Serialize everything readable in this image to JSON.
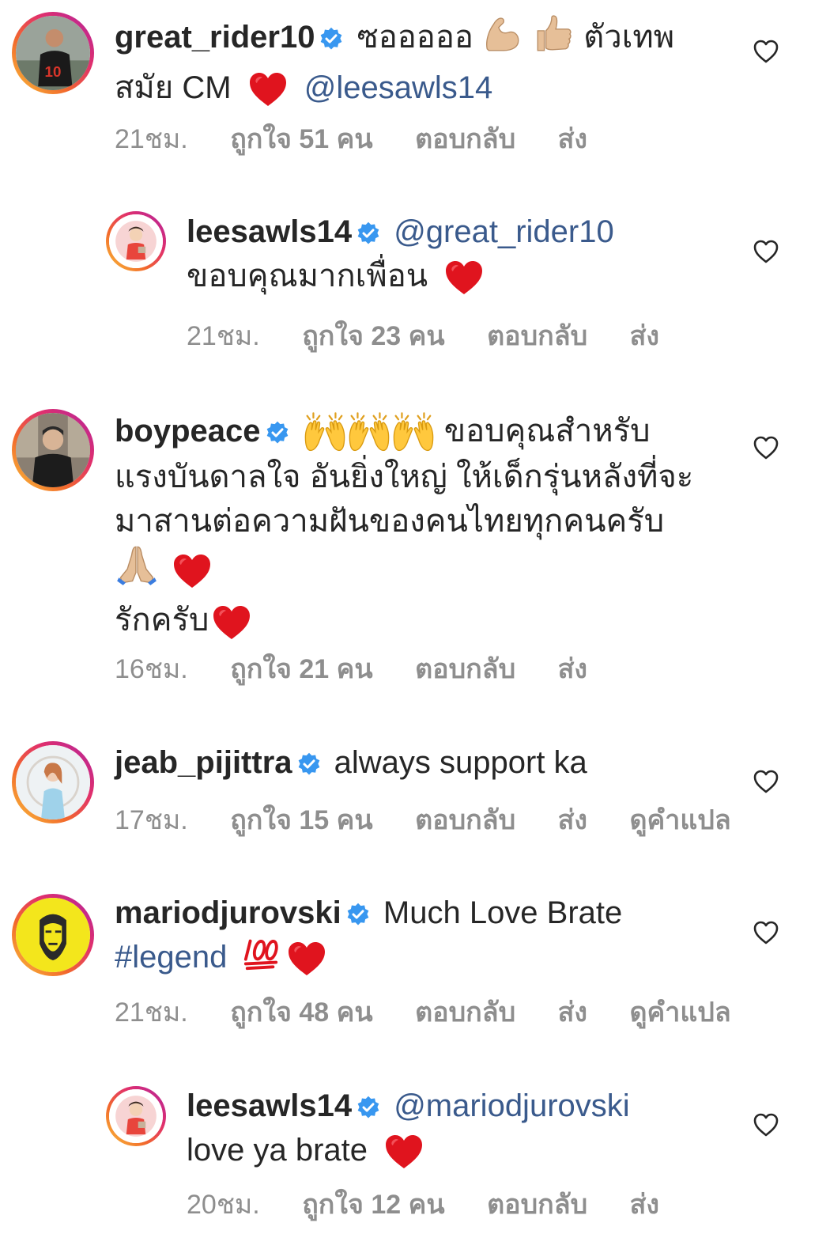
{
  "comments": [
    {
      "username": "great_rider10",
      "text_line1": "ซอออออ",
      "text_line1_tail": "ตัวเทพ",
      "text_line2": "สมัย CM",
      "mention": "@leesawls14",
      "time": "21ชม.",
      "likes": "ถูกใจ 51 คน",
      "reply": "ตอบกลับ",
      "send": "ส่ง"
    },
    {
      "username": "leesawls14",
      "mention": "@great_rider10",
      "text_line2": "ขอบคุณมากเพื่อน",
      "time": "21ชม.",
      "likes": "ถูกใจ 23 คน",
      "reply": "ตอบกลับ",
      "send": "ส่ง"
    },
    {
      "username": "boypeace",
      "text_line1": "ขอบคุณสำหรับ",
      "text_line2": "แรงบันดาลใจ อันยิ่งใหญ่ ให้เด็กรุ่นหลังที่จะ",
      "text_line3": "มาสานต่อความฝันของคนไทยทุกคนครับ",
      "text_line5": "รักครับ",
      "time": "16ชม.",
      "likes": "ถูกใจ 21 คน",
      "reply": "ตอบกลับ",
      "send": "ส่ง"
    },
    {
      "username": "jeab_pijittra",
      "text_line1": "always support ka",
      "time": "17ชม.",
      "likes": "ถูกใจ 15 คน",
      "reply": "ตอบกลับ",
      "send": "ส่ง",
      "translate": "ดูคำแปล"
    },
    {
      "username": "mariodjurovski",
      "text_line1": "Much Love Brate",
      "hashtag": "#legend",
      "time": "21ชม.",
      "likes": "ถูกใจ 48 คน",
      "reply": "ตอบกลับ",
      "send": "ส่ง",
      "translate": "ดูคำแปล"
    },
    {
      "username": "leesawls14",
      "mention": "@mariodjurovski",
      "text_line2": "love ya brate",
      "time": "20ชม.",
      "likes": "ถูกใจ 12 คน",
      "reply": "ตอบกลับ",
      "send": "ส่ง"
    }
  ],
  "icons": {
    "verified": "verified-badge-icon",
    "like": "heart-outline-icon",
    "emoji_heart": "red-heart-emoji",
    "emoji_muscle": "flexed-biceps-emoji",
    "emoji_thumb": "thumbs-up-emoji",
    "emoji_hands": "raising-hands-emoji",
    "emoji_pray": "folded-hands-emoji",
    "emoji_100": "hundred-points-emoji"
  },
  "colors": {
    "text": "#262626",
    "meta": "#8e8e8e",
    "link": "#3a5a8c",
    "verified": "#3897f0",
    "heart_emoji": "#e0141e"
  }
}
